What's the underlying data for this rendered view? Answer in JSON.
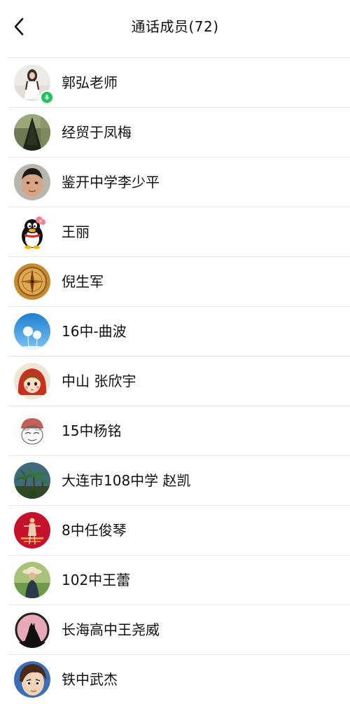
{
  "header": {
    "title": "通话成员(72)"
  },
  "members": [
    {
      "name": "郭弘老师",
      "avatar": "girl-in-white-dress-avatar",
      "speaking": true
    },
    {
      "name": "经贸于凤梅",
      "avatar": "dark-tree-avatar",
      "speaking": false
    },
    {
      "name": "鉴开中学李少平",
      "avatar": "child-face-avatar",
      "speaking": false
    },
    {
      "name": "王丽",
      "avatar": "penguin-avatar",
      "speaking": false
    },
    {
      "name": "倪生军",
      "avatar": "compass-avatar",
      "speaking": false
    },
    {
      "name": "16中-曲波",
      "avatar": "dandelion-sky-avatar",
      "speaking": false
    },
    {
      "name": "中山 张欣宇",
      "avatar": "cartoon-girl-red-hood-avatar",
      "speaking": false
    },
    {
      "name": "15中杨铭",
      "avatar": "sketch-cartoon-avatar",
      "speaking": false
    },
    {
      "name": "大连市108中学 赵凯",
      "avatar": "palm-trees-avatar",
      "speaking": false
    },
    {
      "name": "8中任俊琴",
      "avatar": "red-stage-figure-avatar",
      "speaking": false
    },
    {
      "name": "102中王蕾",
      "avatar": "person-with-hat-avatar",
      "speaking": false
    },
    {
      "name": "长海高中王尧威",
      "avatar": "wolf-moon-avatar",
      "speaking": false
    },
    {
      "name": "铁中武杰",
      "avatar": "anime-face-avatar",
      "speaking": false
    }
  ],
  "colors": {
    "speaking_badge": "#1fc45a",
    "divider": "#e6e6e6"
  }
}
